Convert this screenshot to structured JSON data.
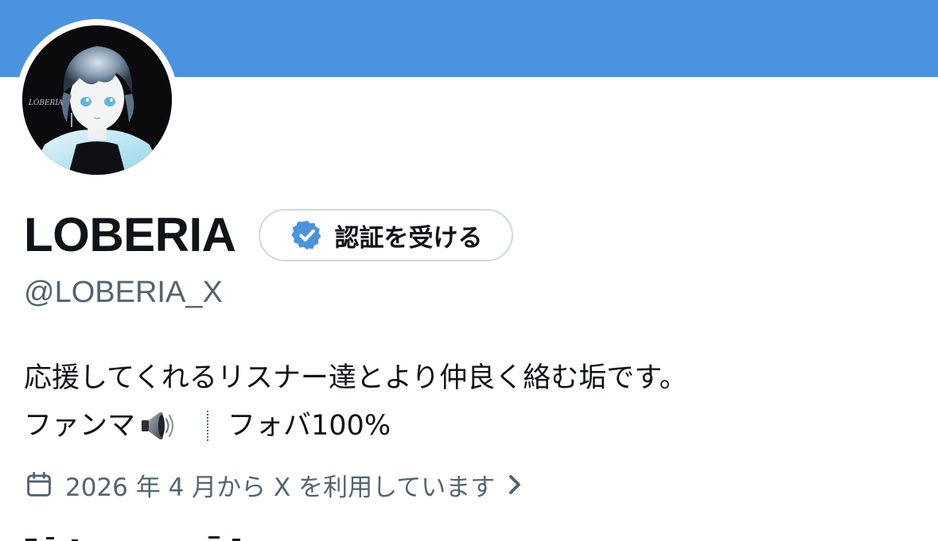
{
  "profile": {
    "display_name": "LOBERIA",
    "handle": "@LOBERIA_X",
    "avatar_text": "LOBERIA",
    "verify_button": {
      "label": "認証を受ける",
      "icon": "verified-badge-icon"
    },
    "bio": {
      "line1": "応援してくれるリスナー達とより仲良く絡む垢です。",
      "line2_part1": "ファンマ",
      "line2_emoji": "speaker-icon",
      "line2_part2": "フォバ100%"
    },
    "joined": {
      "text": "2026 年 4 月から X を利用しています",
      "icon": "calendar-icon",
      "chevron": "chevron-right-icon"
    }
  },
  "colors": {
    "banner": "#4a93df",
    "text_primary": "#0f1419",
    "text_secondary": "#536471",
    "border": "#cfd9de",
    "verified_blue": "#1d9bf0"
  }
}
